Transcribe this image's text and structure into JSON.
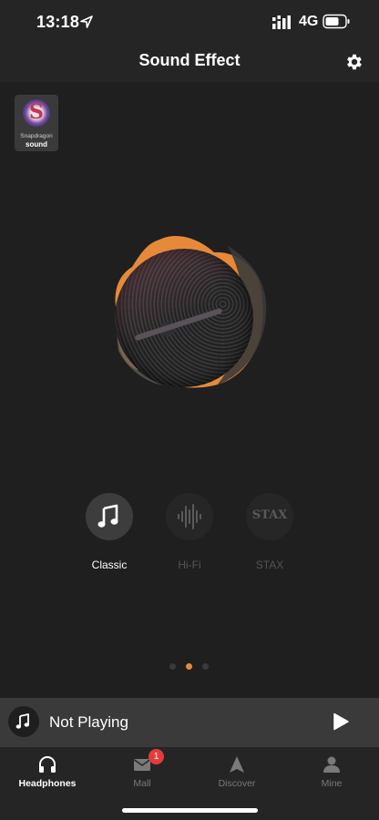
{
  "status_bar": {
    "time": "13:18",
    "location_icon": "location-arrow-icon",
    "signal_icon": "cellular-signal-icon",
    "network": "4G",
    "battery_icon": "battery-icon"
  },
  "header": {
    "title": "Sound Effect",
    "settings_icon": "gear-icon"
  },
  "badge": {
    "brand": "Snapdragon",
    "word": "sound",
    "letter": "S"
  },
  "modes": [
    {
      "label": "Classic",
      "icon": "music-note-icon",
      "selected": true
    },
    {
      "label": "Hi-Fi",
      "icon": "waveform-icon",
      "selected": false
    },
    {
      "label": "STAX",
      "icon": "stax-logo",
      "selected": false
    }
  ],
  "pager": {
    "count": 3,
    "active_index": 1
  },
  "player": {
    "title": "Not Playing",
    "icon": "music-note-icon",
    "play_icon": "play-icon"
  },
  "tabs": [
    {
      "label": "Headphones",
      "icon": "headphones-icon",
      "active": true
    },
    {
      "label": "Mall",
      "icon": "mail-icon",
      "active": false,
      "badge": "1"
    },
    {
      "label": "Discover",
      "icon": "compass-arrow-icon",
      "active": false
    },
    {
      "label": "Mine",
      "icon": "user-icon",
      "active": false
    }
  ],
  "colors": {
    "accent": "#e68a3a",
    "background": "#1f1f1f",
    "badge_red": "#e53b3b"
  }
}
